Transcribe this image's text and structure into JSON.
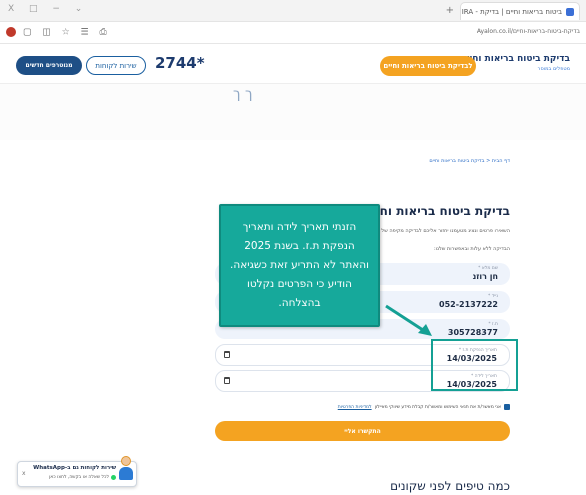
{
  "browser": {
    "window_controls": "X  □  −  ⌄",
    "tab_title": "ביטוח בריאות וחיים | בדיקת - IRA",
    "tab_close": "x",
    "new_tab": "+",
    "url": "Ayalon.co.il/בדיקת-ביטוח-בריאות-וחיים"
  },
  "header": {
    "brand_title": "בדיקת ביטוח בריאות וחיים",
    "brand_sub": "מטפלים במוסר",
    "cta_label": "לבדיקת ביטוח בריאות וחיים",
    "phone": "2744*",
    "service_label": "שירות לקוחות",
    "clients_label": "מנוטרפים חדשים"
  },
  "breadcrumb": "דף הבית < בדיקת ביטוח בריאות וחיים",
  "form": {
    "title": "בדיקת ביטוח בריאות וחיים",
    "description": "השאירו פרטים ונציג מטעמנו יחזור אליכם לבדיקה מקיפה של הביטוחים שלכם.",
    "instruction": "הבדיקה ללא עלות ובאפשרות שלנו:",
    "fields": {
      "name": {
        "label": "שם מלא *",
        "value": "חן רוזנ"
      },
      "phone": {
        "label": "נייד *",
        "value": "052-2137222"
      },
      "id": {
        "label": "ת.ז *",
        "value": "305728377"
      },
      "issue_date": {
        "label": "תאריך הנפקת ת.ז *",
        "value": "14/03/2025"
      },
      "birth_date": {
        "label": "תאריך לידה *",
        "value": "14/03/2025"
      }
    },
    "consent_text": "אני מאשר/ת את תנאי השימוש ומאשר/ת קבלת מידע שיווקי מאיילון",
    "consent_link": "למדיניות הפרטיות",
    "submit_label": "התקשרו אליי"
  },
  "tips_heading": "כמה טיפים לפני שקונים",
  "annotation": {
    "text": "הזנתי תאריך לידה ותאריך הנפקת ת.ז. בשנת 2025 והאתר לא התריע זאת כשגיאה. הודיע כי הפרטים נקלטו בהצלחה."
  },
  "whatsapp": {
    "title": "שירות לקוחות גם ב-WhatsApp",
    "subtitle": "לכל שאלה או בקשה, לחצו כאן",
    "close": "x"
  },
  "hero_decoration": "ך  ך",
  "colors": {
    "accent_orange": "#f4a321",
    "brand_navy": "#1d3b6e",
    "annotation_teal": "#16a99b",
    "whatsapp_green": "#25d366"
  }
}
